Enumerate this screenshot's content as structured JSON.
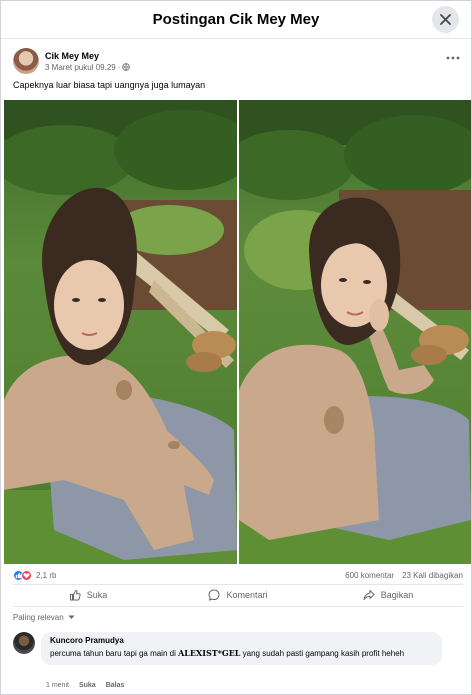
{
  "modal": {
    "title": "Postingan Cik Mey Mey"
  },
  "post": {
    "author": "Cik Mey Mey",
    "date": "3 Maret pukul 09.29",
    "separator": "·",
    "caption": "Capeknya luar biasa tapi uangnya juga lumayan"
  },
  "stats": {
    "reactions": "2,1 rb",
    "comments": "600 komentar",
    "shares": "23 Kali dibagikan"
  },
  "actions": {
    "like": "Suka",
    "comment": "Komentari",
    "share": "Bagikan"
  },
  "sort": {
    "label": "Paling relevan"
  },
  "comment": {
    "author": "Kuncoro Pramudya",
    "text_before": "percuma tahun baru tapi ga main di ",
    "brand": "ALEXIST*GEL",
    "text_after": " yang sudah pasti gampang kasih profit heheh",
    "time": "1 menit",
    "like": "Suka",
    "reply": "Balas"
  },
  "colors": {
    "accent": "#1877f2",
    "love": "#f33e58",
    "muted": "#65676b"
  }
}
